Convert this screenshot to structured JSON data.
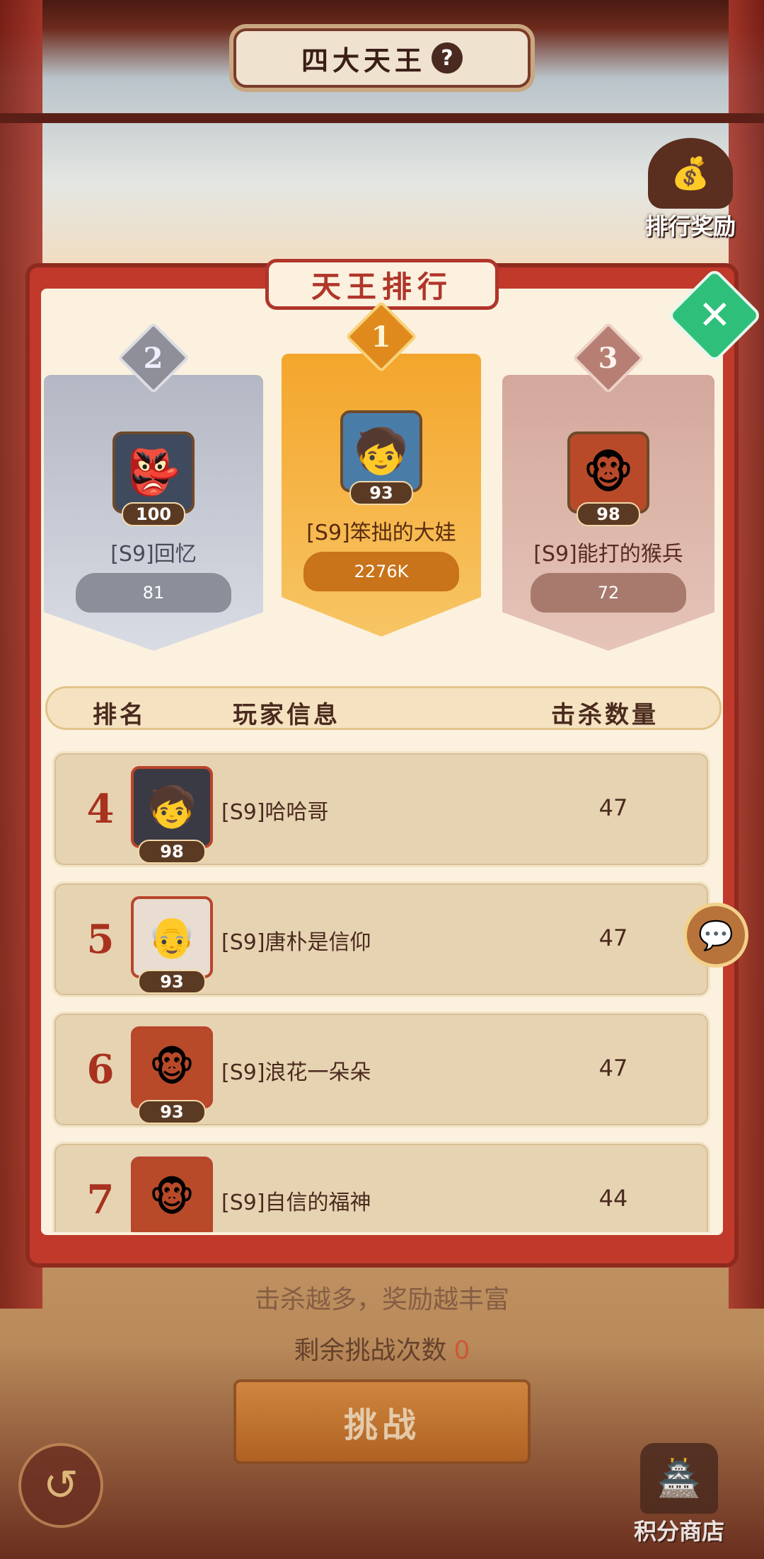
{
  "header": {
    "title": "四大天王",
    "help": "?"
  },
  "rank_reward": {
    "label": "排行奖励",
    "icon": "money-bag-icon"
  },
  "panel": {
    "title": "天王排行",
    "close_icon": "close-icon"
  },
  "podium": [
    {
      "rank": "1",
      "name": "[S9]笨拙的大娃",
      "level": "93",
      "score": "2276K",
      "color": "#f4a62c"
    },
    {
      "rank": "2",
      "name": "[S9]回忆",
      "level": "100",
      "score": "81",
      "color": "#b4b8c4"
    },
    {
      "rank": "3",
      "name": "[S9]能打的猴兵",
      "level": "98",
      "score": "72",
      "color": "#d4a89c"
    }
  ],
  "list_header": {
    "rank": "排名",
    "info": "玩家信息",
    "kills": "击杀数量"
  },
  "rows": [
    {
      "rank": "4",
      "name": "[S9]哈哈哥",
      "level": "98",
      "kills": "47"
    },
    {
      "rank": "5",
      "name": "[S9]唐朴是信仰",
      "level": "93",
      "kills": "47"
    },
    {
      "rank": "6",
      "name": "[S9]浪花一朵朵",
      "level": "93",
      "kills": "47"
    },
    {
      "rank": "7",
      "name": "[S9]自信的福神",
      "level": "",
      "kills": "44"
    }
  ],
  "bottom": {
    "hint": "击杀越多，奖励越丰富",
    "remaining_label": "剩余挑战次数",
    "remaining_count": "0",
    "challenge_label": "挑战",
    "shop_label": "积分商店"
  }
}
